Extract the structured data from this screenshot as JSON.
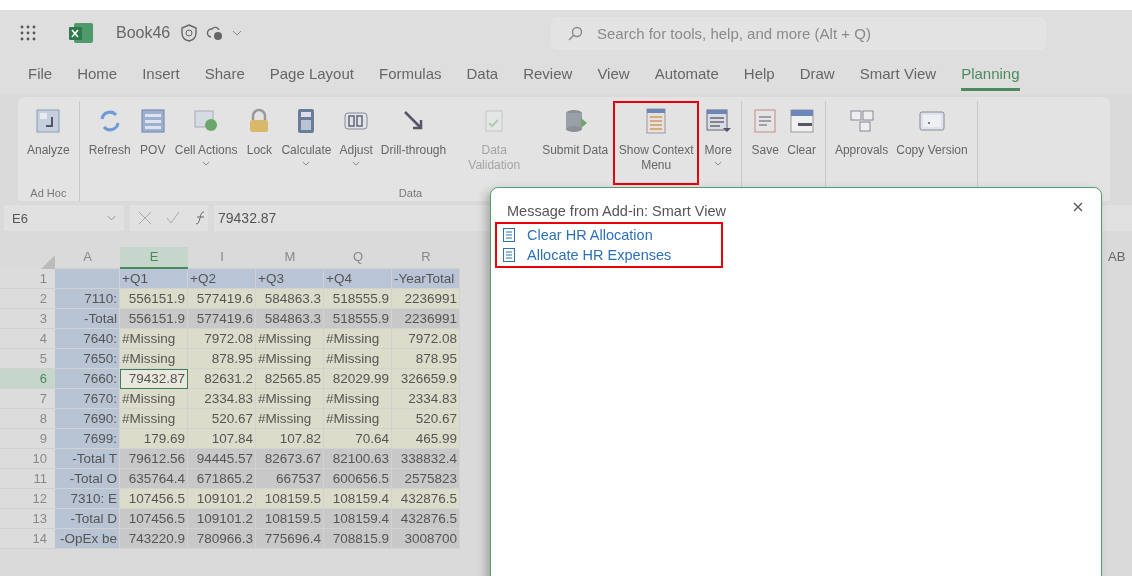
{
  "title_bar": {
    "file_name": "Book46",
    "search": {
      "placeholder": "Search for tools, help, and more (Alt + Q)"
    }
  },
  "tabs": [
    {
      "label": "File",
      "selected": false
    },
    {
      "label": "Home",
      "selected": false
    },
    {
      "label": "Insert",
      "selected": false
    },
    {
      "label": "Share",
      "selected": false
    },
    {
      "label": "Page Layout",
      "selected": false
    },
    {
      "label": "Formulas",
      "selected": false
    },
    {
      "label": "Data",
      "selected": false
    },
    {
      "label": "Review",
      "selected": false
    },
    {
      "label": "View",
      "selected": false
    },
    {
      "label": "Automate",
      "selected": false
    },
    {
      "label": "Help",
      "selected": false
    },
    {
      "label": "Draw",
      "selected": false
    },
    {
      "label": "Smart View",
      "selected": false
    },
    {
      "label": "Planning",
      "selected": true
    }
  ],
  "ribbon": {
    "groups": [
      {
        "label": "Ad Hoc",
        "buttons": [
          {
            "label": "Analyze",
            "dropdown": false,
            "disabled": false,
            "highlighted": false
          }
        ]
      },
      {
        "label": "Data",
        "buttons": [
          {
            "label": "Refresh",
            "dropdown": false,
            "disabled": false,
            "highlighted": false
          },
          {
            "label": "POV",
            "dropdown": false,
            "disabled": false,
            "highlighted": false
          },
          {
            "label": "Cell Actions",
            "dropdown": true,
            "disabled": false,
            "highlighted": false
          },
          {
            "label": "Lock",
            "dropdown": false,
            "disabled": false,
            "highlighted": false
          },
          {
            "label": "Calculate",
            "dropdown": true,
            "disabled": false,
            "highlighted": false
          },
          {
            "label": "Adjust",
            "dropdown": true,
            "disabled": false,
            "highlighted": false
          },
          {
            "label": "Drill-through",
            "dropdown": false,
            "disabled": false,
            "highlighted": false
          },
          {
            "label": "Data Validation",
            "dropdown": false,
            "disabled": true,
            "highlighted": false
          },
          {
            "label": "Submit Data",
            "dropdown": false,
            "disabled": false,
            "highlighted": false
          },
          {
            "label": "Show Context Menu",
            "dropdown": false,
            "disabled": false,
            "highlighted": true
          },
          {
            "label": "More",
            "dropdown": true,
            "disabled": false,
            "highlighted": false
          }
        ]
      },
      {
        "buttons": [
          {
            "label": "Save",
            "dropdown": false,
            "disabled": false,
            "highlighted": false
          },
          {
            "label": "Clear",
            "dropdown": false,
            "disabled": false,
            "highlighted": false
          }
        ]
      },
      {
        "buttons": [
          {
            "label": "Approvals",
            "dropdown": false,
            "disabled": false,
            "highlighted": false
          },
          {
            "label": "Copy Version",
            "dropdown": false,
            "disabled": false,
            "highlighted": false
          }
        ]
      }
    ]
  },
  "formula_bar": {
    "name_box": "E6",
    "formula": "79432.87"
  },
  "grid": {
    "columns": [
      {
        "label": "A",
        "selected": false
      },
      {
        "label": "E",
        "selected": true
      },
      {
        "label": "I",
        "selected": false
      },
      {
        "label": "M",
        "selected": false
      },
      {
        "label": "Q",
        "selected": false
      },
      {
        "label": "R",
        "selected": false
      }
    ],
    "far_column": "AB",
    "rows": [
      {
        "num": "1",
        "kind": "header",
        "selected": false,
        "cells": [
          "",
          "+Q1",
          "+Q2",
          "+Q3",
          "+Q4",
          "-YearTotal"
        ]
      },
      {
        "num": "2",
        "kind": "data",
        "selected": false,
        "cells": [
          "7110:",
          "556151.9",
          "577419.6",
          "584863.3",
          "518555.9",
          "2236991"
        ]
      },
      {
        "num": "3",
        "kind": "total",
        "selected": false,
        "cells": [
          "-Total",
          "556151.9",
          "577419.6",
          "584863.3",
          "518555.9",
          "2236991"
        ]
      },
      {
        "num": "4",
        "kind": "data",
        "selected": false,
        "cells": [
          "7640:",
          {
            "text": "#Missing",
            "kind": "error"
          },
          "7972.08",
          {
            "text": "#Missing",
            "kind": "error"
          },
          {
            "text": "#Missing",
            "kind": "error"
          },
          "7972.08"
        ]
      },
      {
        "num": "5",
        "kind": "data",
        "selected": false,
        "cells": [
          "7650:",
          {
            "text": "#Missing",
            "kind": "error"
          },
          "878.95",
          {
            "text": "#Missing",
            "kind": "error"
          },
          {
            "text": "#Missing",
            "kind": "error"
          },
          "878.95"
        ]
      },
      {
        "num": "6",
        "kind": "data",
        "selected": true,
        "cells": [
          "7660:",
          "79432.87",
          "82631.2",
          "82565.85",
          "82029.99",
          "326659.9"
        ]
      },
      {
        "num": "7",
        "kind": "data",
        "selected": false,
        "cells": [
          "7670:",
          {
            "text": "#Missing",
            "kind": "error"
          },
          "2334.83",
          {
            "text": "#Missing",
            "kind": "error"
          },
          {
            "text": "#Missing",
            "kind": "error"
          },
          "2334.83"
        ]
      },
      {
        "num": "8",
        "kind": "data",
        "selected": false,
        "cells": [
          "7690:",
          {
            "text": "#Missing",
            "kind": "error"
          },
          "520.67",
          {
            "text": "#Missing",
            "kind": "error"
          },
          {
            "text": "#Missing",
            "kind": "error"
          },
          "520.67"
        ]
      },
      {
        "num": "9",
        "kind": "data",
        "selected": false,
        "cells": [
          "7699:",
          "179.69",
          "107.84",
          "107.82",
          "70.64",
          "465.99"
        ]
      },
      {
        "num": "10",
        "kind": "total",
        "selected": false,
        "cells": [
          "-Total T",
          "79612.56",
          "94445.57",
          "82673.67",
          "82100.63",
          "338832.4"
        ]
      },
      {
        "num": "11",
        "kind": "total",
        "selected": false,
        "cells": [
          "-Total O",
          "635764.4",
          "671865.2",
          "667537",
          "600656.5",
          "2575823"
        ]
      },
      {
        "num": "12",
        "kind": "data",
        "selected": false,
        "cells": [
          "7310: E",
          "107456.5",
          "109101.2",
          "108159.5",
          "108159.4",
          "432876.5"
        ]
      },
      {
        "num": "13",
        "kind": "total",
        "selected": false,
        "cells": [
          "-Total D",
          "107456.5",
          "109101.2",
          "108159.5",
          "108159.4",
          "432876.5"
        ]
      },
      {
        "num": "14",
        "kind": "total",
        "selected": false,
        "cells": [
          "-OpEx be",
          "743220.9",
          "780966.3",
          "775696.4",
          "708815.9",
          "3008700"
        ]
      }
    ]
  },
  "dialog": {
    "title": "Message from Add-in: Smart View",
    "highlighted": true,
    "items": [
      {
        "label": "Clear HR Allocation"
      },
      {
        "label": "Allocate HR Expenses"
      }
    ]
  }
}
